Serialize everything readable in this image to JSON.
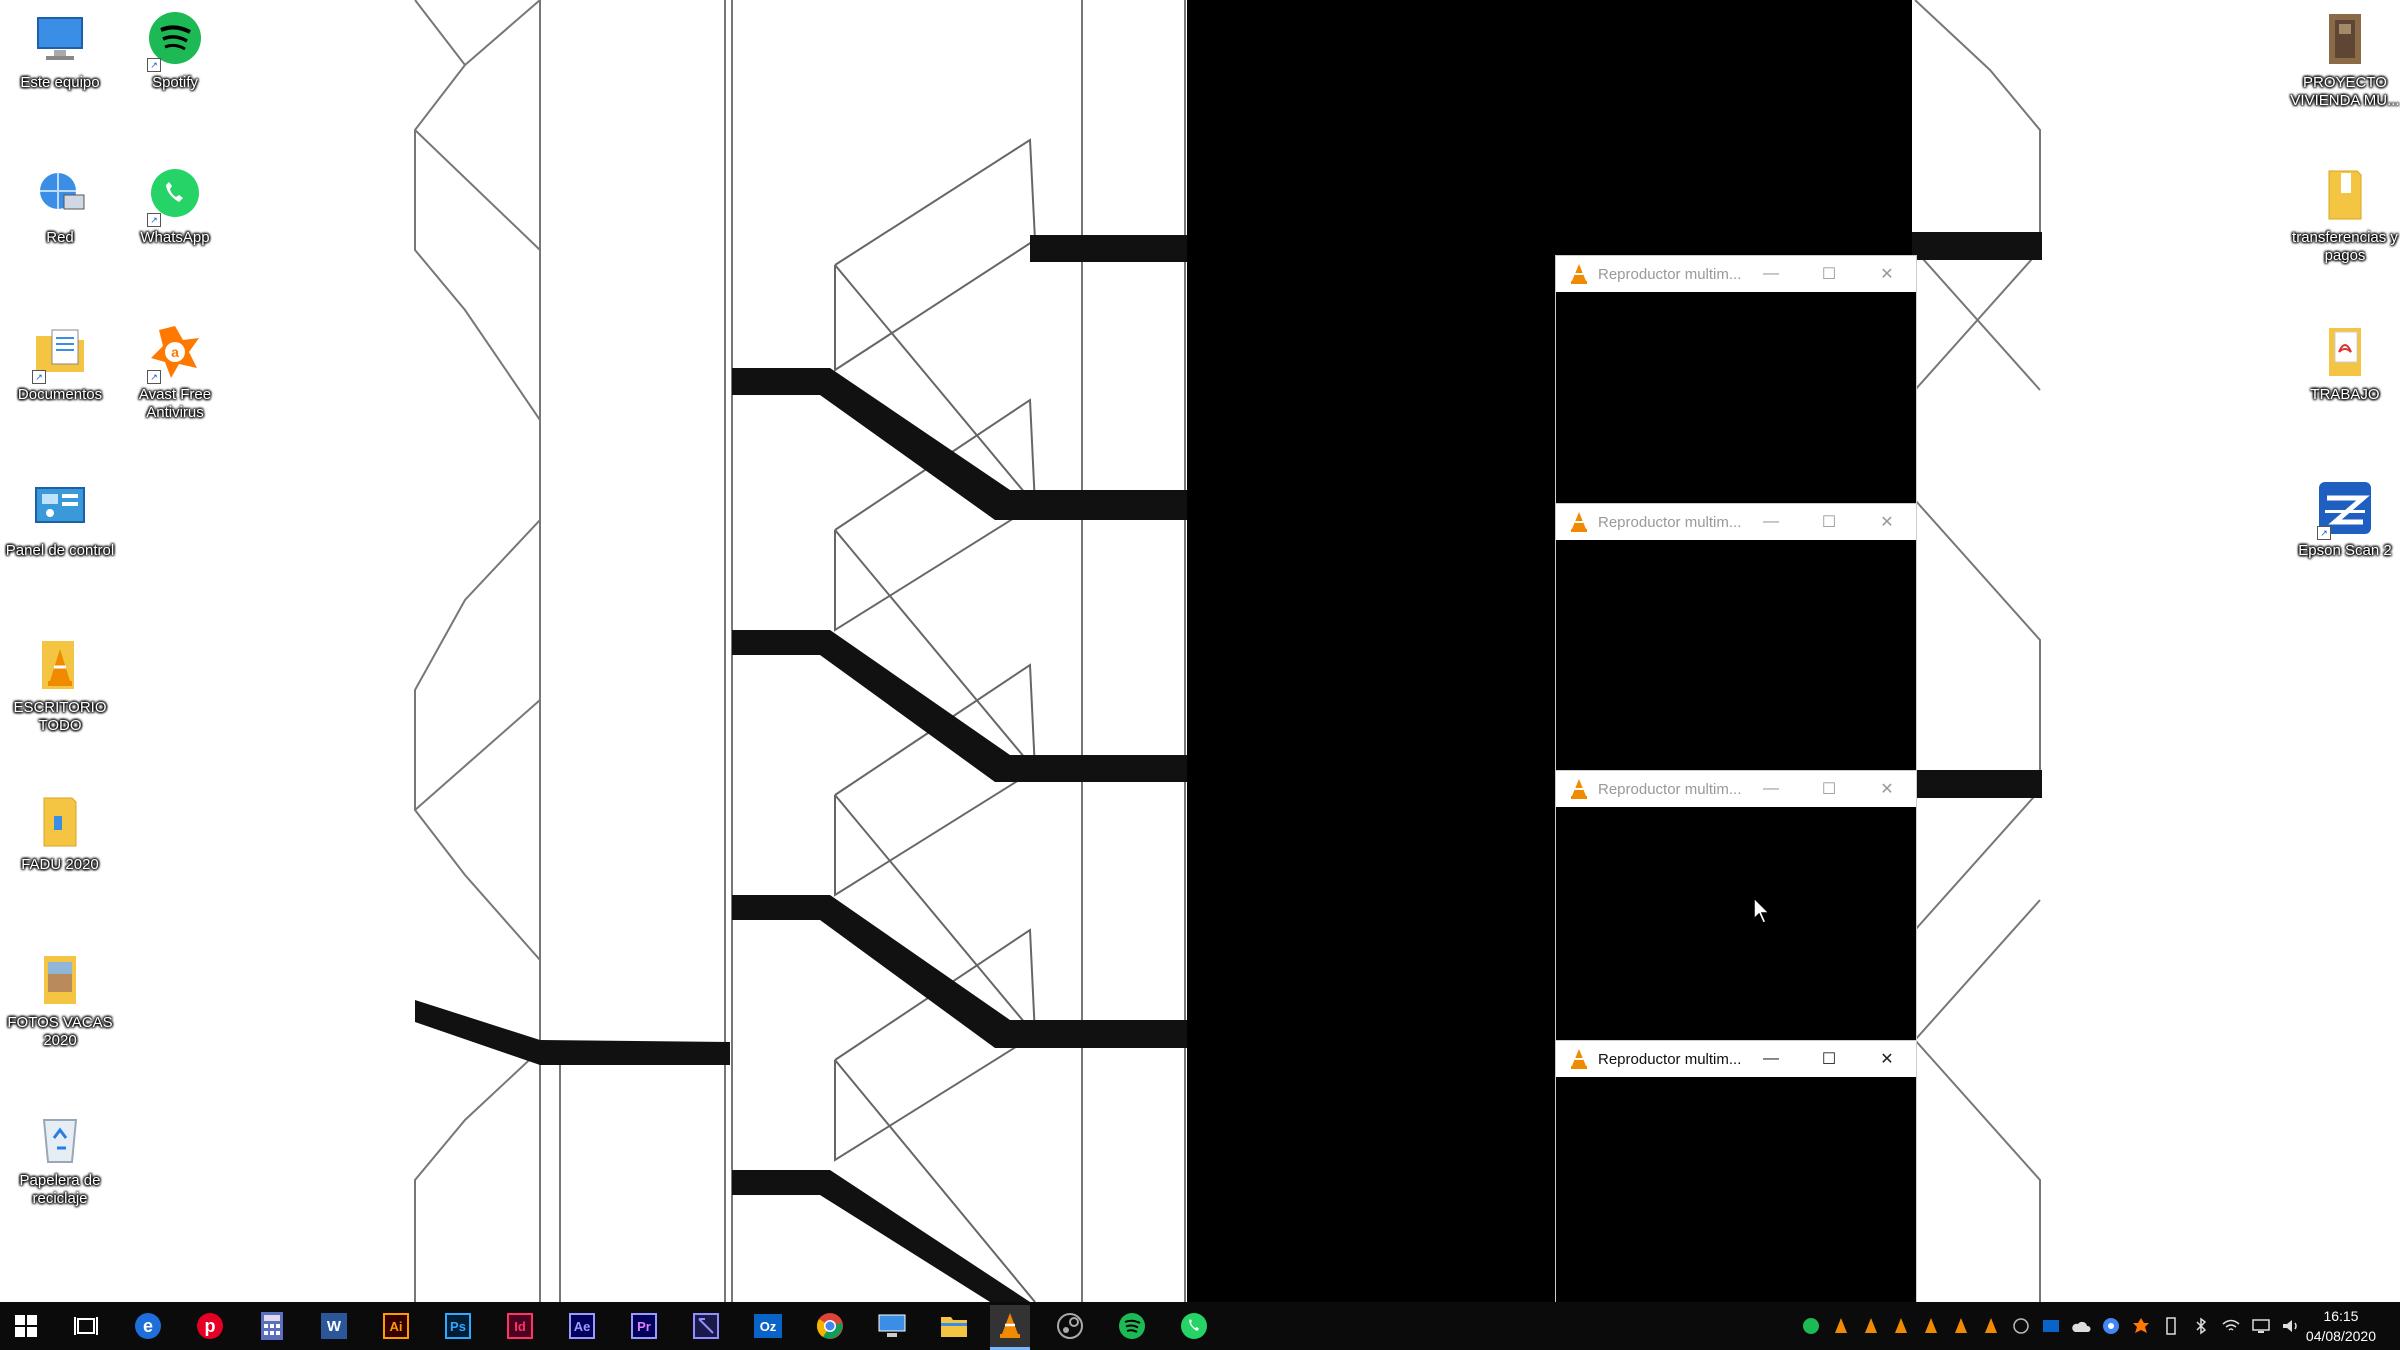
{
  "desktop": {
    "left_icons": [
      {
        "label": "Este equipo",
        "icon": "computer-icon"
      },
      {
        "label": "Spotify",
        "icon": "spotify-icon"
      },
      {
        "label": "Red",
        "icon": "network-icon"
      },
      {
        "label": "WhatsApp",
        "icon": "whatsapp-icon"
      },
      {
        "label": "Documentos",
        "icon": "documents-folder-icon"
      },
      {
        "label": "Avast Free Antivirus",
        "icon": "avast-icon"
      },
      {
        "label": "Panel de control",
        "icon": "control-panel-icon"
      },
      {
        "label": "ESCRITORIO TODO",
        "icon": "vlc-folder-icon"
      },
      {
        "label": "FADU 2020",
        "icon": "folder-icon"
      },
      {
        "label": "FOTOS VACAS 2020",
        "icon": "photo-folder-icon"
      },
      {
        "label": "Papelera de reciclaje",
        "icon": "recycle-bin-icon"
      }
    ],
    "right_icons": [
      {
        "label": "PROYECTO VIVIENDA MU...",
        "icon": "project-folder-icon"
      },
      {
        "label": "transferencias y pagos",
        "icon": "folder-icon"
      },
      {
        "label": "TRABAJO",
        "icon": "pdf-icon"
      },
      {
        "label": "Epson Scan 2",
        "icon": "epson-scan-icon"
      }
    ]
  },
  "vlc_windows": [
    {
      "title": "Reproductor multim...",
      "minimize": "—",
      "maximize": "☐",
      "close": "✕"
    },
    {
      "title": "Reproductor multim...",
      "minimize": "—",
      "maximize": "☐",
      "close": "✕"
    },
    {
      "title": "Reproductor multim...",
      "minimize": "—",
      "maximize": "☐",
      "close": "✕"
    },
    {
      "title": "Reproductor multim...",
      "minimize": "—",
      "maximize": "☐",
      "close": "✕"
    }
  ],
  "taskbar": {
    "apps": [
      "windows-start-icon",
      "task-view-icon",
      "edge-icon",
      "pinterest-icon",
      "calculator-icon",
      "word-icon",
      "illustrator-icon",
      "photoshop-icon",
      "indesign-icon",
      "after-effects-icon",
      "premiere-icon",
      "bridge-icon",
      "outlook-icon",
      "chrome-icon",
      "remote-desktop-icon",
      "file-explorer-icon",
      "vlc-icon",
      "steam-icon",
      "spotify-icon",
      "whatsapp-icon"
    ],
    "app_labels": {
      "ai": "Ai",
      "ps": "Ps",
      "id": "Id",
      "ae": "Ae",
      "pr": "Pr",
      "w": "W",
      "oz": "Oz"
    },
    "tray": [
      "spotify-tray-icon",
      "vlc-tray-icon",
      "vlc-tray-icon",
      "vlc-tray-icon",
      "vlc-tray-icon",
      "vlc-tray-icon",
      "vlc-tray-icon",
      "steam-tray-icon",
      "outlook-tray-icon",
      "onedrive-tray-icon",
      "chrome-tray-icon",
      "avast-tray-icon",
      "usb-tray-icon",
      "bluetooth-tray-icon",
      "wifi-tray-icon",
      "network-tray-icon",
      "volume-tray-icon"
    ],
    "clock": {
      "time": "16:15",
      "date": "04/08/2020"
    }
  },
  "colors": {
    "taskbar": "#0b0b0b",
    "spotify": "#1db954",
    "whatsapp": "#25d366",
    "vlc": "#f08a00",
    "avast": "#ff7800"
  }
}
